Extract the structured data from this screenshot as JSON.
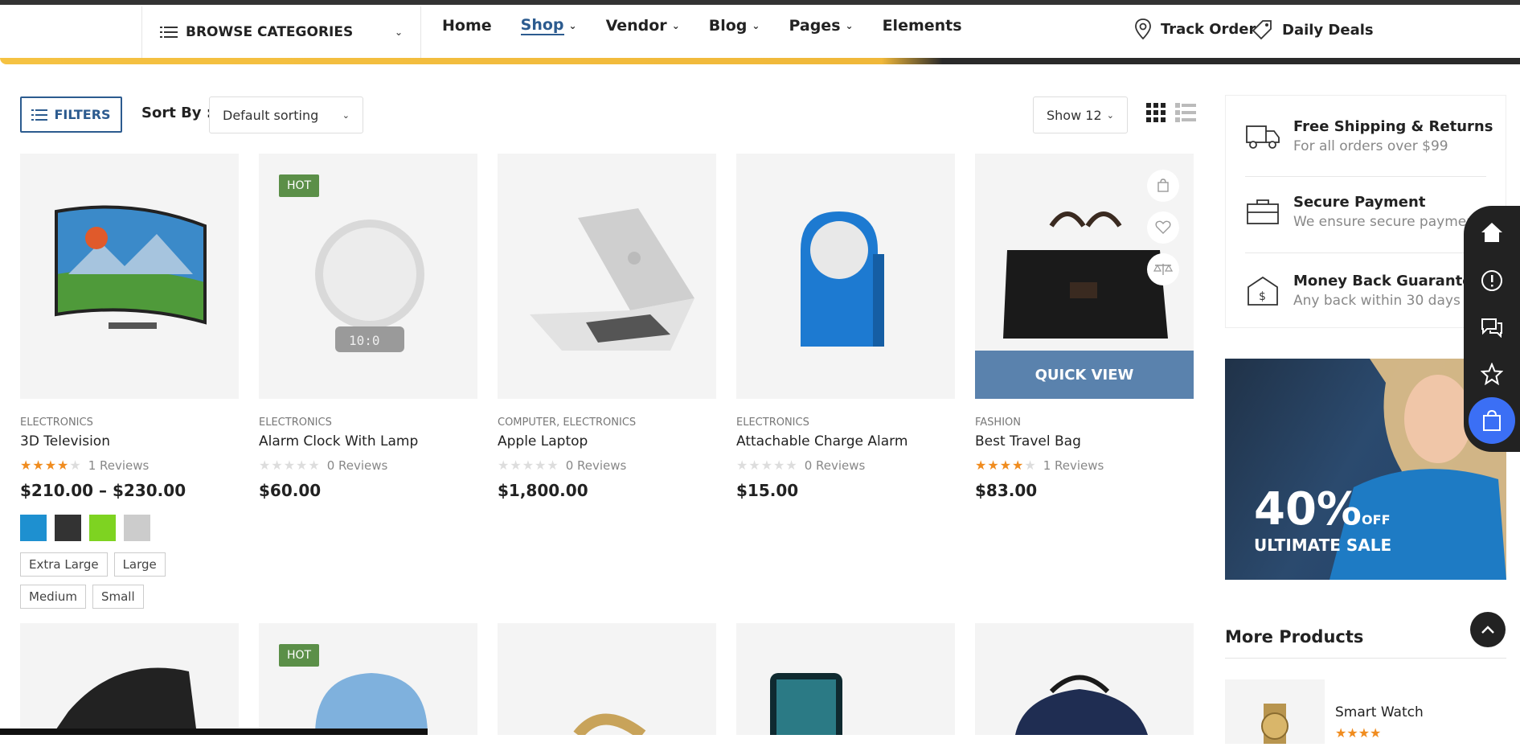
{
  "nav": {
    "browse": "BROWSE CATEGORIES",
    "items": [
      {
        "label": "Home"
      },
      {
        "label": "Shop"
      },
      {
        "label": "Vendor"
      },
      {
        "label": "Blog"
      },
      {
        "label": "Pages"
      },
      {
        "label": "Elements"
      }
    ],
    "track": "Track Order",
    "deals": "Daily Deals"
  },
  "toolbar": {
    "filters": "FILTERS",
    "sort_label": "Sort By :",
    "sort_value": "Default sorting",
    "show_value": "Show 12"
  },
  "products": [
    {
      "cat": "ELECTRONICS",
      "name": "3D Television",
      "reviews": "1 Reviews",
      "price": "$210.00 – $230.00",
      "rating": 4
    },
    {
      "cat": "ELECTRONICS",
      "name": "Alarm Clock With Lamp",
      "reviews": "0 Reviews",
      "price": "$60.00",
      "rating": 0,
      "badge": "HOT"
    },
    {
      "cat": "COMPUTER, ELECTRONICS",
      "name": "Apple Laptop",
      "reviews": "0 Reviews",
      "price": "$1,800.00",
      "rating": 0
    },
    {
      "cat": "ELECTRONICS",
      "name": "Attachable Charge Alarm",
      "reviews": "0 Reviews",
      "price": "$15.00",
      "rating": 0
    },
    {
      "cat": "FASHION",
      "name": "Best Travel Bag",
      "reviews": "1 Reviews",
      "price": "$83.00",
      "rating": 4,
      "quick_view": "QUICK VIEW"
    }
  ],
  "swatches": [
    "#1e90d0",
    "#333333",
    "#7ed321",
    "#cccccc"
  ],
  "sizes": [
    "Extra Large",
    "Large",
    "Medium",
    "Small"
  ],
  "row2_badge": "HOT",
  "sidebar": {
    "features": [
      {
        "title": "Free Shipping & Returns",
        "sub": "For all orders over $99"
      },
      {
        "title": "Secure Payment",
        "sub": "We ensure secure payment"
      },
      {
        "title": "Money Back Guarantee",
        "sub": "Any back within 30 days"
      }
    ],
    "banner": {
      "big": "40%",
      "off": "OFF",
      "line": "ULTIMATE SALE"
    },
    "more_title": "More Products",
    "more_item": "Smart Watch"
  },
  "colors": {
    "accent": "#2c5b8f",
    "hot": "#5b8f48",
    "star": "#f08c1f",
    "cart": "#3b6ff5"
  }
}
